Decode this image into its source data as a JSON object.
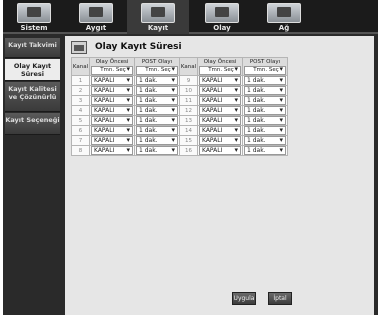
{
  "nav": {
    "tabs": [
      {
        "label": "Sistem",
        "icon": "system-monitor-icon"
      },
      {
        "label": "Aygıt",
        "icon": "camera-icon"
      },
      {
        "label": "Kayıt",
        "icon": "recorder-icon"
      },
      {
        "label": "Olay",
        "icon": "event-icon"
      },
      {
        "label": "Ağ",
        "icon": "network-icon"
      }
    ]
  },
  "sidebar": {
    "items": [
      {
        "label": "Kayıt Takvimi"
      },
      {
        "label": "Olay Kayıt Süresi"
      },
      {
        "label": "Kayıt Kalitesi ve Çözünürlü"
      },
      {
        "label": "Kayıt Seçeneği"
      }
    ]
  },
  "page": {
    "title": "Olay Kayıt Süresi"
  },
  "table": {
    "col_channel": "Kanal",
    "col_pre": "Olay Öncesi",
    "col_post": "POST Olayı",
    "all_pre": "Tmn. Seç",
    "all_post": "Tmn. Seç",
    "rows_left": [
      {
        "ch": "1",
        "pre": "KAPALI",
        "post": "1 dak."
      },
      {
        "ch": "2",
        "pre": "KAPALI",
        "post": "1 dak."
      },
      {
        "ch": "3",
        "pre": "KAPALI",
        "post": "1 dak."
      },
      {
        "ch": "4",
        "pre": "KAPALI",
        "post": "1 dak."
      },
      {
        "ch": "5",
        "pre": "KAPALI",
        "post": "1 dak."
      },
      {
        "ch": "6",
        "pre": "KAPALI",
        "post": "1 dak."
      },
      {
        "ch": "7",
        "pre": "KAPALI",
        "post": "1 dak."
      },
      {
        "ch": "8",
        "pre": "KAPALI",
        "post": "1 dak."
      }
    ],
    "rows_right": [
      {
        "ch": "9",
        "pre": "KAPALI",
        "post": "1 dak."
      },
      {
        "ch": "10",
        "pre": "KAPALI",
        "post": "1 dak."
      },
      {
        "ch": "11",
        "pre": "KAPALI",
        "post": "1 dak."
      },
      {
        "ch": "12",
        "pre": "KAPALI",
        "post": "1 dak."
      },
      {
        "ch": "13",
        "pre": "KAPALI",
        "post": "1 dak."
      },
      {
        "ch": "14",
        "pre": "KAPALI",
        "post": "1 dak."
      },
      {
        "ch": "15",
        "pre": "KAPALI",
        "post": "1 dak."
      },
      {
        "ch": "16",
        "pre": "KAPALI",
        "post": "1 dak."
      }
    ]
  },
  "buttons": {
    "apply": "Uygula",
    "cancel": "İptal"
  }
}
